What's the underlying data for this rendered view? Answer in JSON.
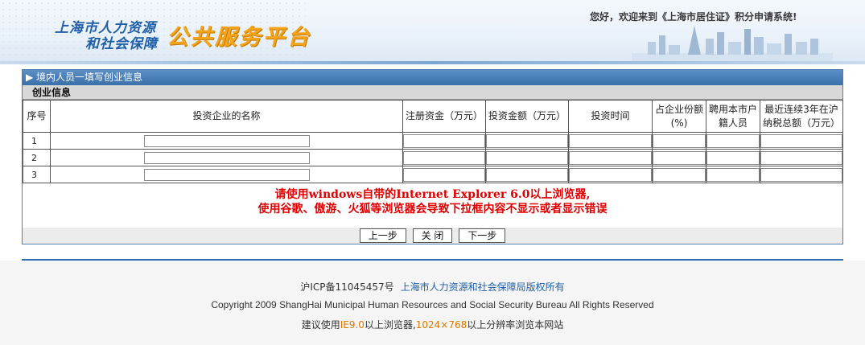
{
  "header": {
    "logo_line1": "上海市人力资源",
    "logo_line2": "和社会保障",
    "logo_main": "公共服务平台",
    "welcome": "您好，欢迎来到《上海市居住证》积分申请系统!"
  },
  "panel": {
    "title": "▶ 境内人员一填写创业信息",
    "section": "创业信息"
  },
  "table": {
    "headers": [
      {
        "label": "序号"
      },
      {
        "label": "投资企业的名称"
      },
      {
        "label": "注册资金（万元）"
      },
      {
        "label": "投资金额（万元）"
      },
      {
        "label": "投资时间"
      },
      {
        "label_l1": "占企业份额",
        "label_l2": "(%)"
      },
      {
        "label_l1": "聘用本市户",
        "label_l2": "籍人员"
      },
      {
        "label_l1": "最近连续3年在沪",
        "label_l2": "纳税总额（万元）"
      }
    ],
    "rows": [
      "1",
      "2",
      "3"
    ]
  },
  "warning": {
    "line1": "请使用windows自带的Internet Explorer 6.0以上浏览器,",
    "line2": "使用谷歌、傲游、火狐等浏览器会导致下拉框内容不显示或者显示错误"
  },
  "buttons": {
    "prev": "上一步",
    "close": "关 闭",
    "next": "下一步"
  },
  "footer": {
    "icp": "沪ICP备11045457号",
    "owner": "上海市人力资源和社会保障局版权所有",
    "copyright": "Copyright 2009 ShangHai Municipal Human Resources and Social Security Bureau All Rights Reserved",
    "advice_pre": "建议使用",
    "advice_ie": "IE9.0",
    "advice_mid": "以上浏览器,",
    "advice_res": "1024×768",
    "advice_post": "以上分辨率浏览本网站"
  },
  "colors": {
    "brand_blue": "#1f5fa8",
    "logo_orange": "#f5a319",
    "warning_red": "#e00000",
    "footer_orange": "#e07800"
  }
}
